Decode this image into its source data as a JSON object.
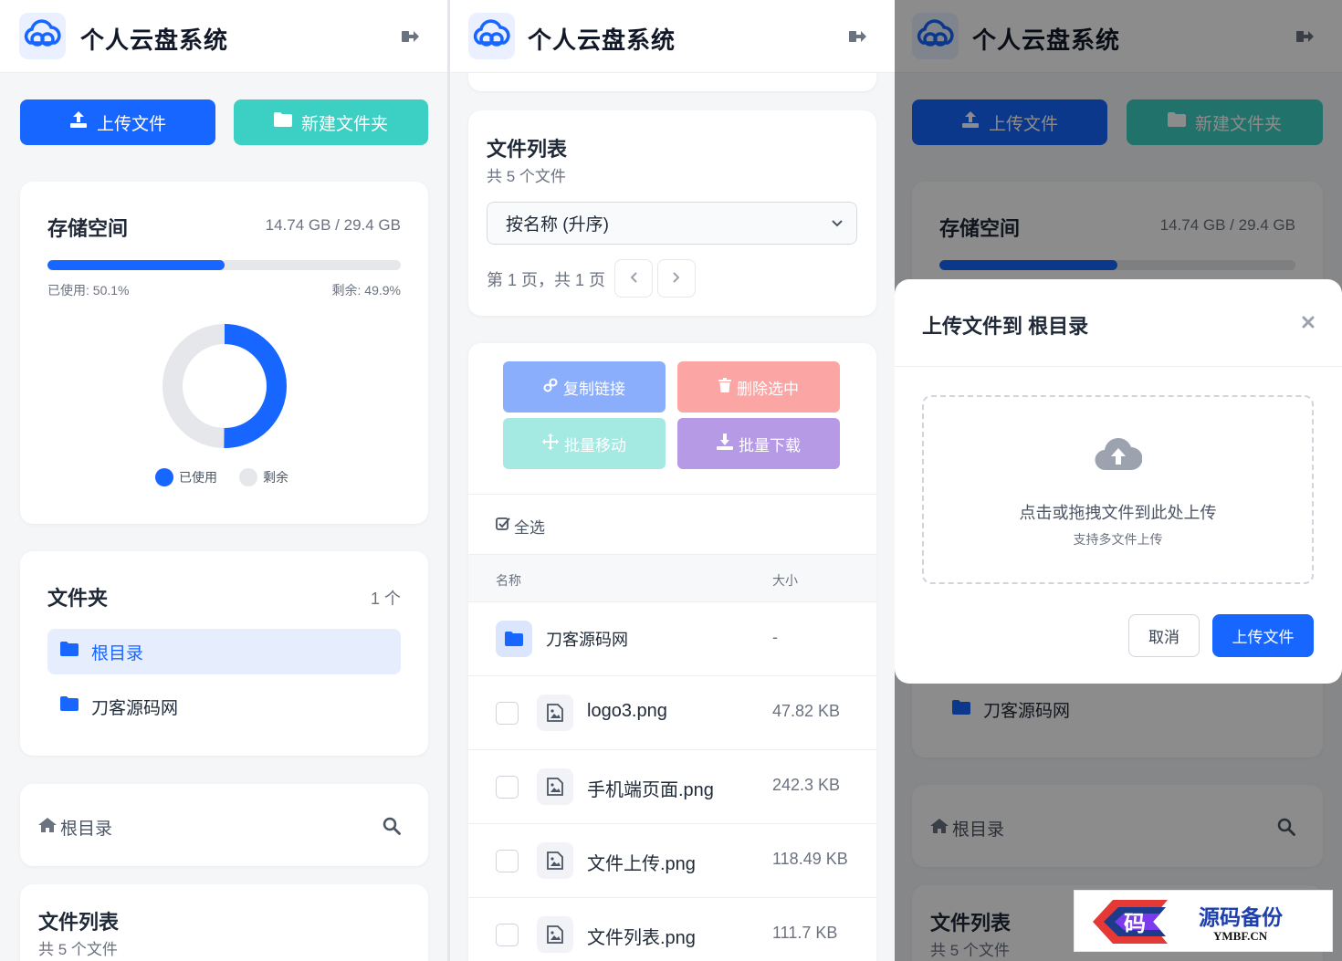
{
  "app": {
    "title": "个人云盘系统"
  },
  "actions": {
    "upload": "上传文件",
    "new_folder": "新建文件夹"
  },
  "storage": {
    "title": "存储空间",
    "usage": "14.74 GB / 29.4 GB",
    "used_label": "已使用: 50.1%",
    "free_label": "剩余: 49.9%",
    "used_fraction": 0.501,
    "legend_used": "已使用",
    "legend_free": "剩余"
  },
  "folders": {
    "title": "文件夹",
    "count": "1 个",
    "items": [
      {
        "label": "根目录"
      },
      {
        "label": "刀客源码网"
      }
    ]
  },
  "breadcrumb": {
    "label": "根目录"
  },
  "file_list": {
    "title": "文件列表",
    "subtitle": "共 5 个文件",
    "sort_selected": "按名称 (升序)",
    "page_info": "第 1 页，共 1 页",
    "batch": {
      "copy_link": "复制链接",
      "delete_selected": "删除选中",
      "batch_move": "批量移动",
      "batch_download": "批量下载"
    },
    "select_all": "全选",
    "columns": {
      "name": "名称",
      "size": "大小"
    },
    "rows": [
      {
        "name": "刀客源码网",
        "size": "-",
        "type": "folder"
      },
      {
        "name": "logo3.png",
        "size": "47.82 KB",
        "type": "image"
      },
      {
        "name": "手机端页面.png",
        "size": "242.3 KB",
        "type": "image"
      },
      {
        "name": "文件上传.png",
        "size": "118.49 KB",
        "type": "image"
      },
      {
        "name": "文件列表.png",
        "size": "111.7 KB",
        "type": "image"
      }
    ]
  },
  "modal": {
    "title": "上传文件到 根目录",
    "drop_text": "点击或拖拽文件到此处上传",
    "drop_hint": "支持多文件上传",
    "cancel": "取消",
    "confirm": "上传文件"
  },
  "watermark": {
    "main": "源码备份",
    "sub": "YMBF.CN",
    "glyph": "码"
  },
  "colors": {
    "primary": "#1766ff",
    "teal": "#3ccfc3",
    "track": "#e5e7eb"
  }
}
